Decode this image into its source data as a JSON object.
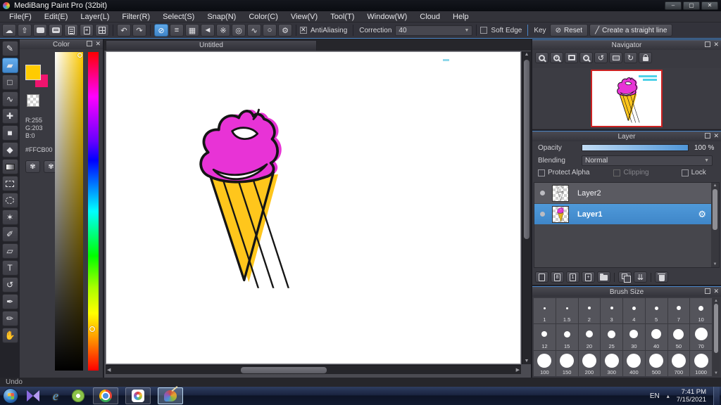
{
  "window": {
    "title": "MediBang Paint Pro (32bit)",
    "controls": [
      {
        "name": "minimize-button",
        "glyph": "–"
      },
      {
        "name": "restore-button",
        "glyph": "▢"
      },
      {
        "name": "close-button",
        "glyph": "✕"
      }
    ]
  },
  "menu": {
    "items": [
      "File(F)",
      "Edit(E)",
      "Layer(L)",
      "Filter(R)",
      "Select(S)",
      "Snap(N)",
      "Color(C)",
      "View(V)",
      "Tool(T)",
      "Window(W)",
      "Cloud",
      "Help"
    ]
  },
  "toolbar": {
    "file_icons": [
      {
        "name": "cloud-icon",
        "glyph": "☁"
      },
      {
        "name": "publish-icon",
        "glyph": "⇧"
      },
      {
        "name": "comment-icon",
        "css": "bubble"
      },
      {
        "name": "comment-text-icon",
        "css": "bubble2"
      },
      {
        "name": "document-icon",
        "css": "docline"
      },
      {
        "name": "document-settings-icon",
        "css": "doc",
        "label": "≡"
      },
      {
        "name": "tiles-icon",
        "css": "tiles"
      }
    ],
    "undo_icon": "↶",
    "redo_icon": "↷",
    "snap_icons": [
      {
        "name": "snap-off-icon",
        "glyph": "⊘",
        "active": true
      },
      {
        "name": "snap-parallel-icon",
        "glyph": "≡"
      },
      {
        "name": "snap-grid-icon",
        "glyph": "▦"
      },
      {
        "name": "snap-vanishing-icon",
        "glyph": "◄"
      },
      {
        "name": "snap-radial-icon",
        "glyph": "※"
      },
      {
        "name": "snap-concentric-icon",
        "glyph": "◎"
      },
      {
        "name": "snap-curve-icon",
        "glyph": "∿"
      },
      {
        "name": "snap-ellipse-icon",
        "glyph": "○"
      },
      {
        "name": "snap-settings-icon",
        "glyph": "⚙"
      }
    ],
    "antialiasing_label": "AntiAliasing",
    "correction_label": "Correction",
    "correction_value": "40",
    "soft_edge_label": "Soft Edge",
    "key_label": "Key",
    "reset_label": "Reset",
    "straight_line_label": "Create a straight line"
  },
  "tools": [
    {
      "name": "brush-tool",
      "glyph": "✎"
    },
    {
      "name": "eraser-tool",
      "glyph": "▰",
      "selected": true
    },
    {
      "name": "shape-tool",
      "glyph": "□"
    },
    {
      "name": "control-point-tool",
      "glyph": "∿"
    },
    {
      "name": "move-tool",
      "glyph": "✚"
    },
    {
      "name": "fill-rect-tool",
      "glyph": "■"
    },
    {
      "name": "bucket-tool",
      "glyph": "◆"
    },
    {
      "name": "gradient-tool",
      "css": "grad"
    },
    {
      "name": "select-tool",
      "css": "dashrect"
    },
    {
      "name": "lasso-tool",
      "css": "dashcirc"
    },
    {
      "name": "magic-wand-tool",
      "glyph": "✶"
    },
    {
      "name": "select-pen-tool",
      "glyph": "✐"
    },
    {
      "name": "select-eraser-tool",
      "glyph": "▱"
    },
    {
      "name": "text-tool",
      "glyph": "T"
    },
    {
      "name": "rotate-tool",
      "glyph": "↺"
    },
    {
      "name": "eyedropper-tool",
      "glyph": "✒"
    },
    {
      "name": "pen-tool",
      "glyph": "✏"
    },
    {
      "name": "hand-tool",
      "glyph": "✋"
    }
  ],
  "color_panel": {
    "title": "Color",
    "r_label": "R:255",
    "g_label": "G:203",
    "b_label": "B:0",
    "hex": "#FFCB00",
    "foreground_color": "#FFCB00",
    "secondary_color": "#F0146E"
  },
  "canvas": {
    "tab_label": "Untitled"
  },
  "navigator": {
    "title": "Navigator",
    "buttons": [
      {
        "name": "zoom-select-icon",
        "css": "mag"
      },
      {
        "name": "zoom-in-icon",
        "css": "mag",
        "label": "+"
      },
      {
        "name": "fit-screen-icon",
        "css": "fit"
      },
      {
        "name": "zoom-out-icon",
        "css": "mag",
        "label": "-"
      },
      {
        "name": "rotate-left-icon",
        "glyph": "↺"
      },
      {
        "name": "rotate-reset-icon",
        "css": "rect"
      },
      {
        "name": "rotate-right-icon",
        "glyph": "↻"
      },
      {
        "name": "lock-icon",
        "css": "lock"
      }
    ]
  },
  "layer_panel": {
    "title": "Layer",
    "opacity_label": "Opacity",
    "opacity_value": "100 %",
    "blending_label": "Blending",
    "blending_value": "Normal",
    "protect_alpha_label": "Protect Alpha",
    "clipping_label": "Clipping",
    "lock_label": "Lock",
    "layers": [
      {
        "name": "Layer2",
        "selected": false
      },
      {
        "name": "Layer1",
        "selected": true
      }
    ],
    "buttons": [
      {
        "name": "new-layer-button",
        "css": "doc"
      },
      {
        "name": "new-8bit-layer-button",
        "css": "doc",
        "label": "8"
      },
      {
        "name": "new-1bit-layer-button",
        "css": "doc",
        "label": "1"
      },
      {
        "name": "add-layer-menu-button",
        "css": "doc",
        "label": "+"
      },
      {
        "name": "folder-button",
        "css": "folder"
      },
      {
        "name": "divider"
      },
      {
        "name": "duplicate-layer-button",
        "css": "copy"
      },
      {
        "name": "merge-layer-button",
        "glyph": "⇊"
      },
      {
        "name": "divider"
      },
      {
        "name": "delete-layer-button",
        "css": "trash"
      }
    ]
  },
  "brush_panel": {
    "title": "Brush Size",
    "sizes": [
      "1",
      "1.5",
      "2",
      "3",
      "4",
      "5",
      "7",
      "10",
      "12",
      "15",
      "20",
      "25",
      "30",
      "40",
      "50",
      "70",
      "100",
      "150",
      "200",
      "300",
      "400",
      "500",
      "700",
      "1000"
    ]
  },
  "status": {
    "undo_label": "Undo"
  },
  "taskbar": {
    "language": "EN",
    "tray_expand_icon": "▴",
    "time": "7:41 PM",
    "date": "7/15/2021",
    "apps": [
      {
        "name": "kmplayer-icon",
        "css": "km"
      },
      {
        "name": "internet-explorer-icon",
        "css": "ie",
        "label": "e"
      },
      {
        "name": "photoscape-icon",
        "css": "ps"
      },
      {
        "name": "chrome-icon",
        "css": "chrome",
        "framed": true
      },
      {
        "name": "medibang-launcher-icon",
        "css": "mb",
        "framed": true
      },
      {
        "name": "medibang-paint-icon",
        "css": "paint",
        "framed": true,
        "active": true
      }
    ]
  },
  "colors": {
    "accent_blue": "#4a96d8",
    "selection_blue": "#4390d2",
    "icecream_magenta": "#E833D6",
    "cone_yellow": "#FFC61C",
    "thumb_border_red": "#cc2222"
  }
}
